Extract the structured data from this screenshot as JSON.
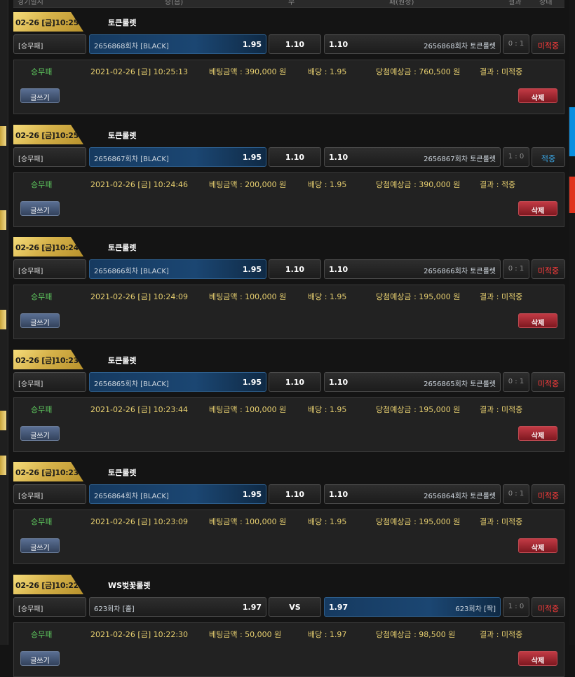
{
  "header": {
    "col_time": "경기일시",
    "col_home": "승(홈)",
    "col_draw": "무",
    "col_away": "패(원정)",
    "col_result": "결과",
    "col_status": "상태"
  },
  "colors": {
    "gold": "#d6b24a",
    "selected_blue": "#1b4672",
    "pending_red": "#ff3b3b",
    "win_blue": "#3aa8e8",
    "type_green": "#5ec85e",
    "detail_yellow": "#e8d070"
  },
  "icons": {},
  "bets": [
    {
      "date_tag": "02-26 [금]10:25",
      "game": "토큰룰렛",
      "bet_type": "[승무패]",
      "home_label": "2656868회차 [BLACK]",
      "home_odds": "1.95",
      "draw_odds": "1.10",
      "away_odds": "1.10",
      "away_label": "2656868회차 토큰룰렛",
      "score": "0 : 1",
      "status": "미적중",
      "detail_type": "승무패",
      "detail_datetime": "2021-02-26 [금] 10:25:13",
      "detail_amount": "베팅금액 : 390,000 원",
      "detail_odds": "배당 : 1.95",
      "detail_win": "당첨예상금 : 760,500 원",
      "detail_result": "결과 : 미적중",
      "write_label": "글쓰기",
      "delete_label": "삭제"
    },
    {
      "date_tag": "02-26 [금]10:25",
      "game": "토큰룰렛",
      "bet_type": "[승무패]",
      "home_label": "2656867회차 [BLACK]",
      "home_odds": "1.95",
      "draw_odds": "1.10",
      "away_odds": "1.10",
      "away_label": "2656867회차 토큰룰렛",
      "score": "1 : 0",
      "status": "적중",
      "detail_type": "승무패",
      "detail_datetime": "2021-02-26 [금] 10:24:46",
      "detail_amount": "베팅금액 : 200,000 원",
      "detail_odds": "배당 : 1.95",
      "detail_win": "당첨예상금 : 390,000 원",
      "detail_result": "결과 : 적중",
      "write_label": "글쓰기",
      "delete_label": "삭제"
    },
    {
      "date_tag": "02-26 [금]10:24",
      "game": "토큰룰렛",
      "bet_type": "[승무패]",
      "home_label": "2656866회차 [BLACK]",
      "home_odds": "1.95",
      "draw_odds": "1.10",
      "away_odds": "1.10",
      "away_label": "2656866회차 토큰룰렛",
      "score": "0 : 1",
      "status": "미적중",
      "detail_type": "승무패",
      "detail_datetime": "2021-02-26 [금] 10:24:09",
      "detail_amount": "베팅금액 : 100,000 원",
      "detail_odds": "배당 : 1.95",
      "detail_win": "당첨예상금 : 195,000 원",
      "detail_result": "결과 : 미적중",
      "write_label": "글쓰기",
      "delete_label": "삭제"
    },
    {
      "date_tag": "02-26 [금]10:23",
      "game": "토큰룰렛",
      "bet_type": "[승무패]",
      "home_label": "2656865회차 [BLACK]",
      "home_odds": "1.95",
      "draw_odds": "1.10",
      "away_odds": "1.10",
      "away_label": "2656865회차 토큰룰렛",
      "score": "0 : 1",
      "status": "미적중",
      "detail_type": "승무패",
      "detail_datetime": "2021-02-26 [금] 10:23:44",
      "detail_amount": "베팅금액 : 100,000 원",
      "detail_odds": "배당 : 1.95",
      "detail_win": "당첨예상금 : 195,000 원",
      "detail_result": "결과 : 미적중",
      "write_label": "글쓰기",
      "delete_label": "삭제"
    },
    {
      "date_tag": "02-26 [금]10:23",
      "game": "토큰룰렛",
      "bet_type": "[승무패]",
      "home_label": "2656864회차 [BLACK]",
      "home_odds": "1.95",
      "draw_odds": "1.10",
      "away_odds": "1.10",
      "away_label": "2656864회차 토큰룰렛",
      "score": "0 : 1",
      "status": "미적중",
      "detail_type": "승무패",
      "detail_datetime": "2021-02-26 [금] 10:23:09",
      "detail_amount": "베팅금액 : 100,000 원",
      "detail_odds": "배당 : 1.95",
      "detail_win": "당첨예상금 : 195,000 원",
      "detail_result": "결과 : 미적중",
      "write_label": "글쓰기",
      "delete_label": "삭제"
    },
    {
      "date_tag": "02-26 [금]10:22",
      "game": "WS벚꽃룰렛",
      "bet_type": "[승무패]",
      "home_label": "623회차 [홀]",
      "home_odds": "1.97",
      "draw_odds": "VS",
      "away_odds": "1.97",
      "away_label": "623회차 [짝]",
      "score": "1 : 0",
      "status": "미적중",
      "detail_type": "승무패",
      "detail_datetime": "2021-02-26 [금] 10:22:30",
      "detail_amount": "베팅금액 : 50,000 원",
      "detail_odds": "배당 : 1.97",
      "detail_win": "당첨예상금 : 98,500 원",
      "detail_result": "결과 : 미적중",
      "write_label": "글쓰기",
      "delete_label": "삭제"
    }
  ]
}
